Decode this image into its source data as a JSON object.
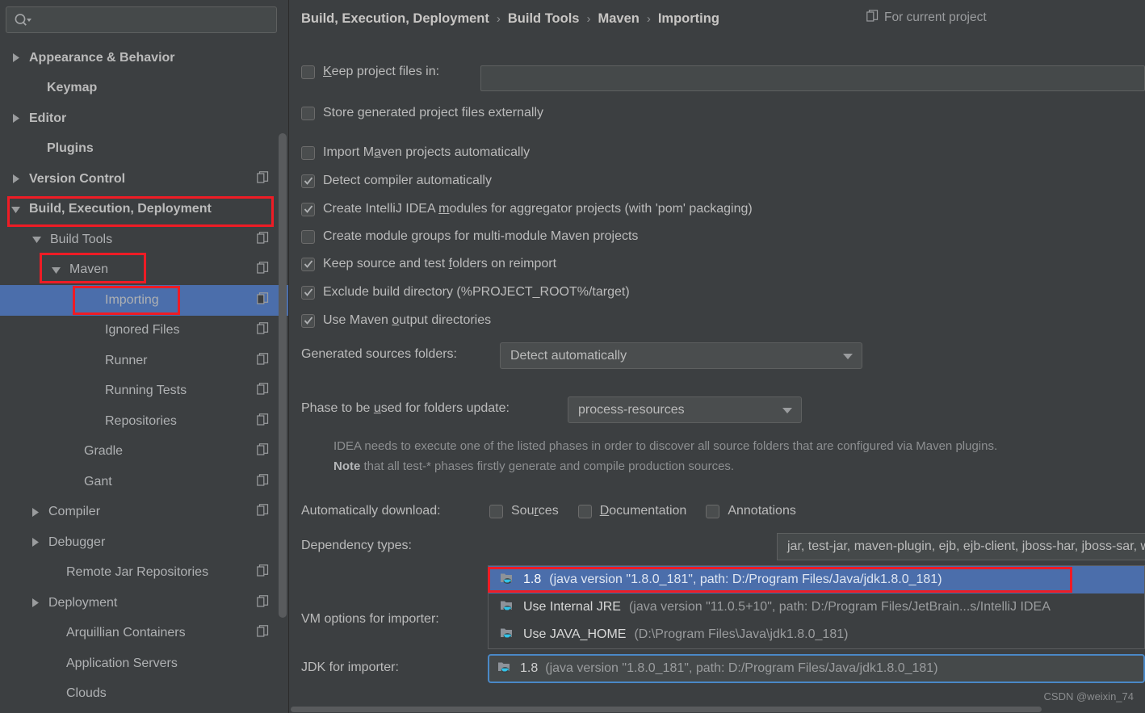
{
  "search": {
    "placeholder": "",
    "value": "",
    "icon": "search-icon"
  },
  "sidebar": {
    "items": [
      {
        "label": "Appearance & Behavior",
        "arrow": "right",
        "indent": 14,
        "bold": true,
        "badge": false,
        "selected": false
      },
      {
        "label": "Keymap",
        "arrow": "none",
        "indent": 36,
        "bold": true,
        "badge": false,
        "selected": false
      },
      {
        "label": "Editor",
        "arrow": "right",
        "indent": 14,
        "bold": true,
        "badge": false,
        "selected": false
      },
      {
        "label": "Plugins",
        "arrow": "none",
        "indent": 36,
        "bold": true,
        "badge": false,
        "selected": false
      },
      {
        "label": "Version Control",
        "arrow": "right",
        "indent": 14,
        "bold": true,
        "badge": true,
        "selected": false
      },
      {
        "label": "Build, Execution, Deployment",
        "arrow": "down",
        "indent": 14,
        "bold": true,
        "badge": false,
        "selected": false
      },
      {
        "label": "Build Tools",
        "arrow": "down",
        "indent": 40,
        "bold": false,
        "badge": true,
        "selected": false
      },
      {
        "label": "Maven",
        "arrow": "down",
        "indent": 64,
        "bold": false,
        "badge": true,
        "selected": false
      },
      {
        "label": "Importing",
        "arrow": "none",
        "indent": 108,
        "bold": false,
        "badge": true,
        "selected": true
      },
      {
        "label": "Ignored Files",
        "arrow": "none",
        "indent": 108,
        "bold": false,
        "badge": true,
        "selected": false
      },
      {
        "label": "Runner",
        "arrow": "none",
        "indent": 108,
        "bold": false,
        "badge": true,
        "selected": false
      },
      {
        "label": "Running Tests",
        "arrow": "none",
        "indent": 108,
        "bold": false,
        "badge": true,
        "selected": false
      },
      {
        "label": "Repositories",
        "arrow": "none",
        "indent": 108,
        "bold": false,
        "badge": true,
        "selected": false
      },
      {
        "label": "Gradle",
        "arrow": "none",
        "indent": 82,
        "bold": false,
        "badge": true,
        "selected": false
      },
      {
        "label": "Gant",
        "arrow": "none",
        "indent": 82,
        "bold": false,
        "badge": true,
        "selected": false
      },
      {
        "label": "Compiler",
        "arrow": "right",
        "indent": 38,
        "bold": false,
        "badge": true,
        "selected": false
      },
      {
        "label": "Debugger",
        "arrow": "right",
        "indent": 38,
        "bold": false,
        "badge": false,
        "selected": false
      },
      {
        "label": "Remote Jar Repositories",
        "arrow": "none",
        "indent": 60,
        "bold": false,
        "badge": true,
        "selected": false
      },
      {
        "label": "Deployment",
        "arrow": "right",
        "indent": 38,
        "bold": false,
        "badge": true,
        "selected": false
      },
      {
        "label": "Arquillian Containers",
        "arrow": "none",
        "indent": 60,
        "bold": false,
        "badge": true,
        "selected": false
      },
      {
        "label": "Application Servers",
        "arrow": "none",
        "indent": 60,
        "bold": false,
        "badge": false,
        "selected": false
      },
      {
        "label": "Clouds",
        "arrow": "none",
        "indent": 60,
        "bold": false,
        "badge": false,
        "selected": false
      }
    ]
  },
  "header": {
    "breadcrumb": [
      "Build, Execution, Deployment",
      "Build Tools",
      "Maven",
      "Importing"
    ],
    "separator": "›",
    "scope_label": "For current project",
    "scope_icon": "copy-badge-icon"
  },
  "main": {
    "keep_project_files": {
      "label_pre": "",
      "mnemonic": "K",
      "label_post": "eep project files in:",
      "checked": false,
      "value": ""
    },
    "checkboxes": [
      {
        "pre": "Store generated project files externally",
        "mnemonic": "",
        "post": "",
        "checked": false
      },
      {
        "pre": "Import M",
        "mnemonic": "a",
        "post": "ven projects automatically",
        "checked": false
      },
      {
        "pre": "Detect compiler automatically",
        "mnemonic": "",
        "post": "",
        "checked": true
      },
      {
        "pre": "Create IntelliJ IDEA ",
        "mnemonic": "m",
        "post": "odules for aggregator projects (with 'pom' packaging)",
        "checked": true
      },
      {
        "pre": "Create module ",
        "mnemonic": "g",
        "post": "roups for multi-module Maven projects",
        "checked": false
      },
      {
        "pre": "Keep source and test ",
        "mnemonic": "f",
        "post": "olders on reimport",
        "checked": true
      },
      {
        "pre": "Exclude build directory (%PROJECT_ROOT%/target)",
        "mnemonic": "",
        "post": "",
        "checked": true
      },
      {
        "pre": "Use Maven ",
        "mnemonic": "o",
        "post": "utput directories",
        "checked": true
      }
    ],
    "generated_sources": {
      "label": "Generated sources folders:",
      "value": "Detect automatically"
    },
    "phase": {
      "label_pre": "Phase to be ",
      "mnemonic": "u",
      "label_post": "sed for folders update:",
      "value": "process-resources"
    },
    "note_line1": "IDEA needs to execute one of the listed phases in order to discover all source folders that are configured via Maven plugins.",
    "note_bold": "Note",
    "note_line2": " that all test-* phases firstly generate and compile production sources.",
    "auto_download": {
      "label": "Automatically download:",
      "options": [
        {
          "pre": "Sou",
          "mnemonic": "r",
          "post": "ces",
          "checked": false
        },
        {
          "pre": "",
          "mnemonic": "D",
          "post": "ocumentation",
          "checked": false
        },
        {
          "pre": "Annotations",
          "mnemonic": "",
          "post": "",
          "checked": false
        }
      ]
    },
    "dependency_types": {
      "label": "Dependency types:",
      "value": "jar, test-jar, maven-plugin, ejb, ejb-client, jboss-har, jboss-sar, war, ear, bundle"
    },
    "vm_options": {
      "label": "VM options for importer:"
    },
    "jdk_for_importer": {
      "label": "JDK for importer:",
      "value_main": "1.8",
      "value_detail": "(java version \"1.8.0_181\", path: D:/Program Files/Java/jdk1.8.0_181)"
    },
    "jdk_popup": {
      "items": [
        {
          "main": "1.8",
          "detail": "(java version \"1.8.0_181\", path: D:/Program Files/Java/jdk1.8.0_181)",
          "selected": true
        },
        {
          "main": "Use Internal JRE",
          "detail": "(java version \"11.0.5+10\", path: D:/Program Files/JetBrain...s/IntelliJ IDEA",
          "selected": false
        },
        {
          "main": "Use JAVA_HOME",
          "detail": "(D:\\Program Files\\Java\\jdk1.8.0_181)",
          "selected": false
        }
      ]
    }
  },
  "watermark": "CSDN @weixin_74",
  "colors": {
    "background": "#3c3f41",
    "selection_blue": "#4b6eab",
    "annotation_red": "#ee1c25",
    "focus_blue": "#4a88c7",
    "text": "#bbbbbb",
    "dim_text": "#9a9c9e"
  }
}
